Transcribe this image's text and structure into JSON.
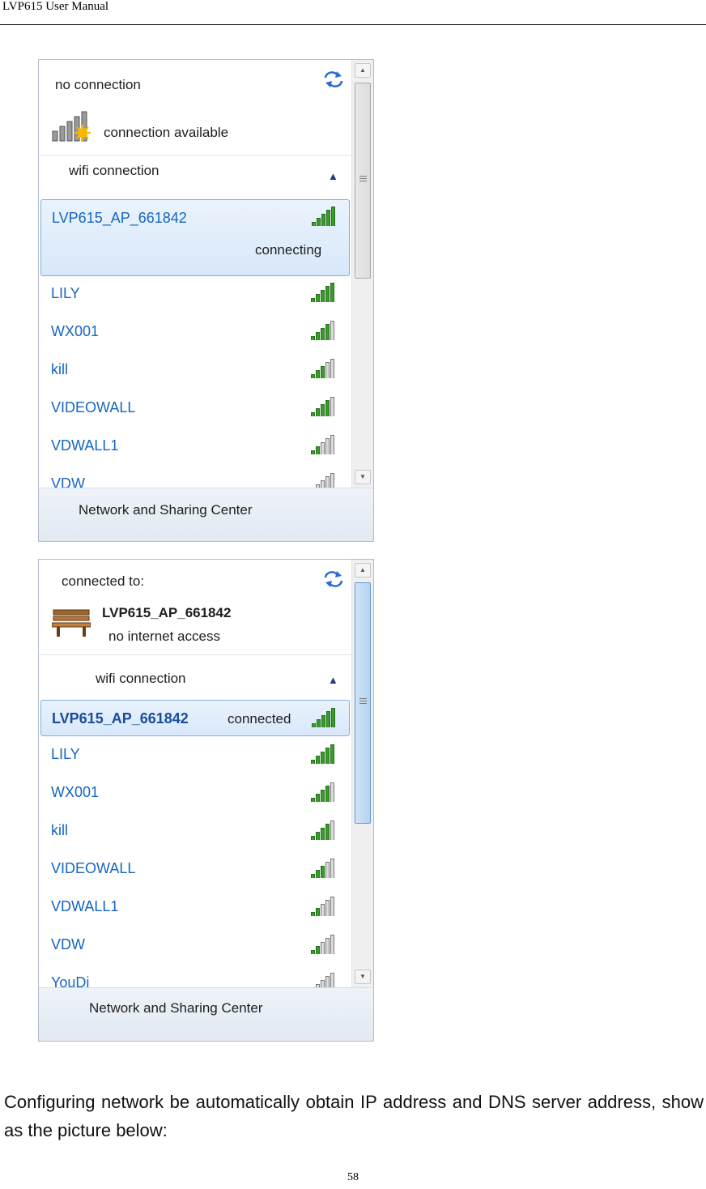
{
  "header": {
    "title": "LVP615 User Manual"
  },
  "panel1": {
    "status_title": "no connection",
    "status_sub": "connection available",
    "section": "wifi connection",
    "selected": {
      "name": "LVP615_AP_661842",
      "state": "connecting"
    },
    "networks": [
      {
        "name": "LILY",
        "signal": 5
      },
      {
        "name": "WX001",
        "signal": 4
      },
      {
        "name": "kill",
        "signal": 3
      },
      {
        "name": "VIDEOWALL",
        "signal": 4
      },
      {
        "name": "VDWALL1",
        "signal": 2
      },
      {
        "name": "VDW",
        "signal": 1
      }
    ],
    "footer": "Network and Sharing Center"
  },
  "panel2": {
    "status_title": "connected to:",
    "status_network": "LVP615_AP_661842",
    "status_sub": "no internet access",
    "section": "wifi connection",
    "selected": {
      "name": "LVP615_AP_661842",
      "state": "connected"
    },
    "networks": [
      {
        "name": "LILY",
        "signal": 5
      },
      {
        "name": "WX001",
        "signal": 4
      },
      {
        "name": "kill",
        "signal": 4
      },
      {
        "name": "VIDEOWALL",
        "signal": 3
      },
      {
        "name": "VDWALL1",
        "signal": 2
      },
      {
        "name": "VDW",
        "signal": 2
      },
      {
        "name": "YouDi",
        "signal": 1
      }
    ],
    "footer": "Network and Sharing Center"
  },
  "caption": "Configuring network be automatically obtain IP address and DNS server address, show as the picture below:",
  "page_number": "58",
  "colors": {
    "link_blue": "#1565c0",
    "signal_green": "#3a9a2c",
    "selection": "#d8e8fa"
  }
}
